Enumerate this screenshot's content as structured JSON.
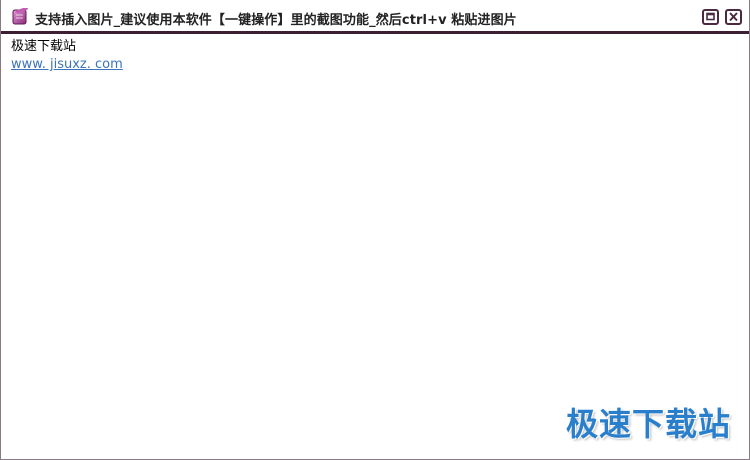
{
  "window": {
    "title": "支持插入图片_建议使用本软件【一键操作】里的截图功能_然后ctrl+v 粘贴进图片",
    "icon": "app-icon",
    "controls": {
      "maximize_icon": "maximize-icon",
      "close_icon": "close-icon"
    }
  },
  "content": {
    "lines": [
      "极速下载站"
    ],
    "link_text": "www. jisuxz. com"
  },
  "watermark": {
    "text": "极速下载站"
  },
  "colors": {
    "titlebar_border": "#3d1f35",
    "link": "#3b74b8",
    "watermark": "#2a7fcc"
  }
}
